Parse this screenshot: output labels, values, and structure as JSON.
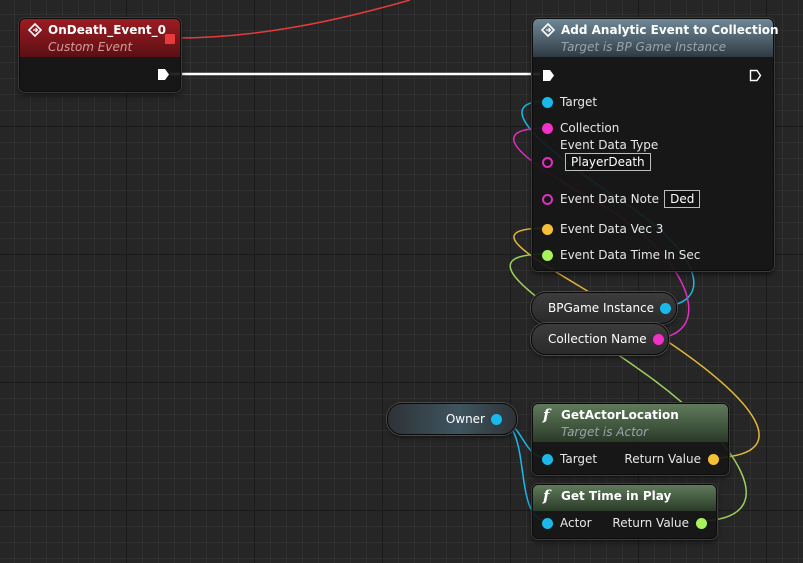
{
  "event_node": {
    "title": "OnDeath_Event_0",
    "subtitle": "Custom Event"
  },
  "analytic_node": {
    "title": "Add Analytic Event to Collection",
    "subtitle": "Target is BP Game Instance",
    "pins": {
      "target": "Target",
      "collection": "Collection",
      "event_data_type": "Event Data Type",
      "event_data_type_value": "PlayerDeath",
      "event_data_note": "Event Data Note",
      "event_data_note_value": "Ded",
      "event_data_vec3": "Event Data Vec 3",
      "event_data_time": "Event Data Time In Sec"
    }
  },
  "variables": {
    "bp_game_instance": "BPGame Instance",
    "collection_name": "Collection Name",
    "owner": "Owner"
  },
  "get_actor_location": {
    "title": "GetActorLocation",
    "subtitle": "Target is Actor",
    "input": "Target",
    "output": "Return Value"
  },
  "get_time_in_play": {
    "title": "Get Time in Play",
    "input": "Actor",
    "output": "Return Value"
  },
  "colors": {
    "exec_wire": "#ffffff",
    "object_pin": "#1ab9ea",
    "string_pin": "#f032c8",
    "vector_pin": "#f5c033",
    "float_pin": "#a8f25a",
    "event_header": "#9b1c22",
    "delegate_pin": "#e63b3b"
  }
}
